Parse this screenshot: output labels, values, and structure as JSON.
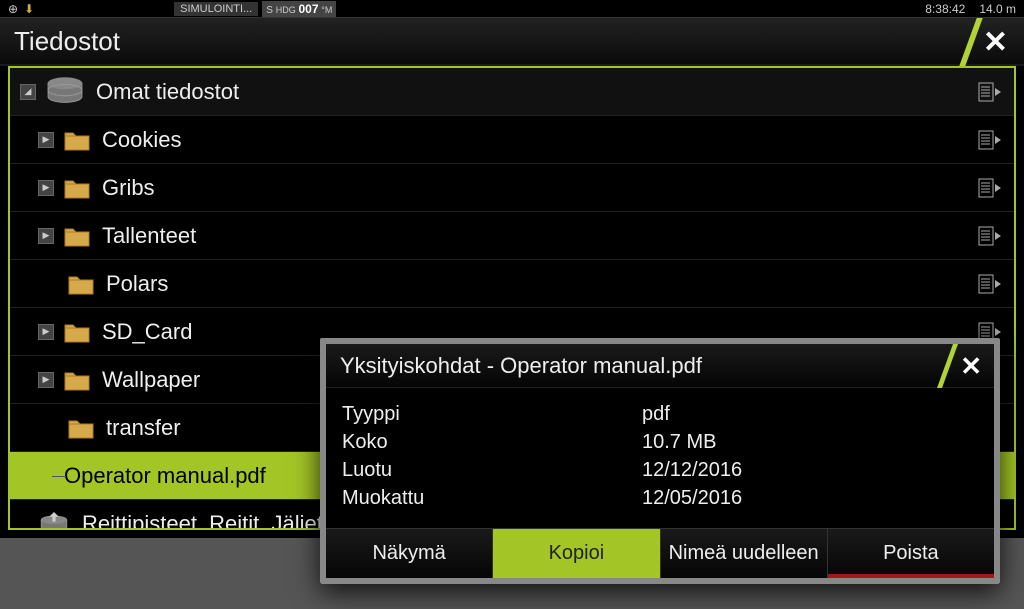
{
  "statusbar": {
    "sim_label": "SIMULOINTI...",
    "hdg_prefix": "S",
    "hdg_label": "HDG",
    "hdg_value": "007",
    "hdg_unit": "°M",
    "time": "8:38:42",
    "depth": "14.0 m"
  },
  "window": {
    "title": "Tiedostot"
  },
  "tree": {
    "root": "Omat tiedostot",
    "items": [
      {
        "label": "Cookies",
        "expandable": true
      },
      {
        "label": "Gribs",
        "expandable": true
      },
      {
        "label": "Tallenteet",
        "expandable": true
      },
      {
        "label": "Polars",
        "expandable": false
      },
      {
        "label": "SD_Card",
        "expandable": true
      },
      {
        "label": "Wallpaper",
        "expandable": true
      },
      {
        "label": "transfer",
        "expandable": false
      },
      {
        "label": "Operator manual.pdf",
        "expandable": false,
        "selected": true,
        "file": true
      }
    ],
    "routes": "Reittipisteet, Reitit, Jäljet ja..."
  },
  "popup": {
    "title": "Yksityiskohdat - Operator manual.pdf",
    "rows": [
      {
        "label": "Tyyppi",
        "value": "pdf"
      },
      {
        "label": "Koko",
        "value": "10.7 MB"
      },
      {
        "label": "Luotu",
        "value": "12/12/2016"
      },
      {
        "label": "Muokattu",
        "value": "12/05/2016"
      }
    ],
    "buttons": {
      "view": "Näkymä",
      "copy": "Kopioi",
      "rename": "Nimeä uudelleen",
      "delete": "Poista"
    }
  }
}
